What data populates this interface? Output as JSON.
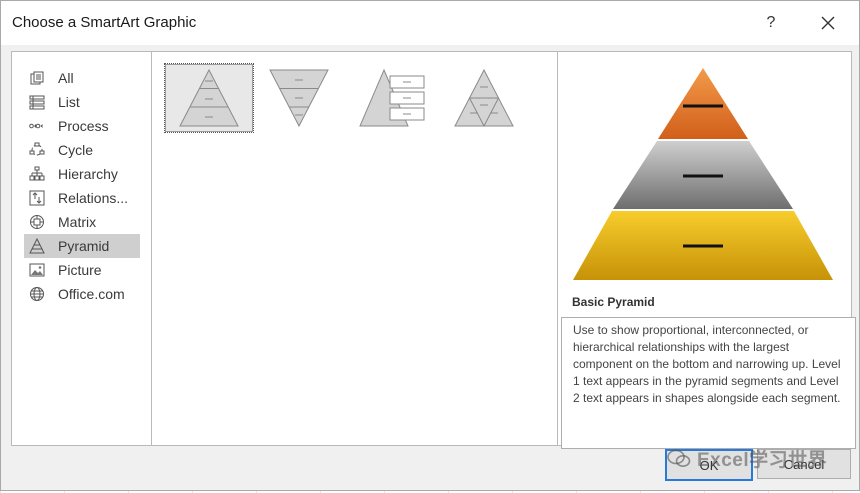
{
  "dialog": {
    "title": "Choose a SmartArt Graphic",
    "help_label": "?",
    "close_label": "✕"
  },
  "categories": [
    {
      "label": "All",
      "icon": "all-icon",
      "selected": false
    },
    {
      "label": "List",
      "icon": "list-icon",
      "selected": false
    },
    {
      "label": "Process",
      "icon": "process-icon",
      "selected": false
    },
    {
      "label": "Cycle",
      "icon": "cycle-icon",
      "selected": false
    },
    {
      "label": "Hierarchy",
      "icon": "hierarchy-icon",
      "selected": false
    },
    {
      "label": "Relations...",
      "icon": "relationship-icon",
      "selected": false
    },
    {
      "label": "Matrix",
      "icon": "matrix-icon",
      "selected": false
    },
    {
      "label": "Pyramid",
      "icon": "pyramid-icon",
      "selected": true
    },
    {
      "label": "Picture",
      "icon": "picture-icon",
      "selected": false
    },
    {
      "label": "Office.com",
      "icon": "globe-icon",
      "selected": false
    }
  ],
  "gallery": [
    {
      "icon": "basic-pyramid-icon",
      "selected": true
    },
    {
      "icon": "inverted-pyramid-icon",
      "selected": false
    },
    {
      "icon": "pyramid-list-icon",
      "selected": false
    },
    {
      "icon": "segmented-pyramid-icon",
      "selected": false
    }
  ],
  "preview": {
    "name": "Basic Pyramid",
    "description": "Use to show proportional, interconnected, or hierarchical relationships with the largest component on the bottom and narrowing up. Level 1 text appears in the pyramid segments and Level 2 text appears in shapes alongside each segment.",
    "colors": {
      "top": "#e2712a",
      "middle": "#8c8c8c",
      "bottom": "#e6b21c"
    }
  },
  "buttons": {
    "ok_label": "OK",
    "cancel_label": "Cancel"
  },
  "watermark": {
    "text": "Excel学习世界"
  }
}
